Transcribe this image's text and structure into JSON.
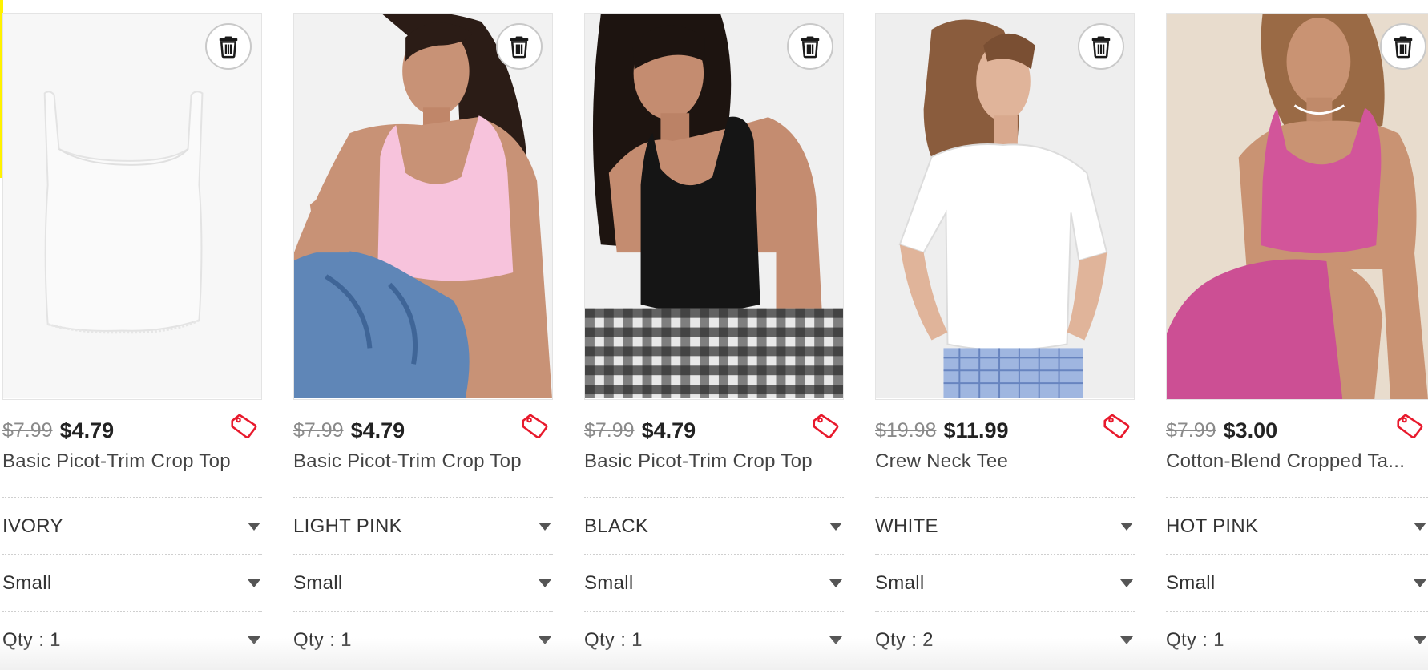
{
  "cart": {
    "items": [
      {
        "old_price": "$7.99",
        "new_price": "$4.79",
        "name": "Basic Picot-Trim Crop Top",
        "color": "IVORY",
        "size": "Small",
        "qty": "Qty : 1",
        "image": {
          "garment": "ivory tank top",
          "garment_color": "#f6f6f6",
          "background": "#f7f7f7"
        }
      },
      {
        "old_price": "$7.99",
        "new_price": "$4.79",
        "name": "Basic Picot-Trim Crop Top",
        "color": "LIGHT PINK",
        "size": "Small",
        "qty": "Qty : 1",
        "image": {
          "garment": "light pink tank top",
          "garment_color": "#f7c3dc",
          "background": "#f2f2f2"
        }
      },
      {
        "old_price": "$7.99",
        "new_price": "$4.79",
        "name": "Basic Picot-Trim Crop Top",
        "color": "BLACK",
        "size": "Small",
        "qty": "Qty : 1",
        "image": {
          "garment": "black tank top",
          "garment_color": "#151515",
          "background": "#f0f0f0"
        }
      },
      {
        "old_price": "$19.98",
        "new_price": "$11.99",
        "name": "Crew Neck Tee",
        "color": "WHITE",
        "size": "Small",
        "qty": "Qty : 2",
        "image": {
          "garment": "white crew neck tee",
          "garment_color": "#ffffff",
          "background": "#eeeeee"
        }
      },
      {
        "old_price": "$7.99",
        "new_price": "$3.00",
        "name": "Cotton-Blend Cropped Ta...",
        "color": "HOT PINK",
        "size": "Small",
        "qty": "Qty : 1",
        "image": {
          "garment": "hot pink cropped tank",
          "garment_color": "#d2559a",
          "background": "#e8dccd"
        }
      }
    ]
  },
  "icons": {
    "remove": "trash-icon",
    "sale": "price-tag-icon",
    "dropdown": "chevron-down-icon"
  },
  "colors": {
    "sale_tag": "#e8192c",
    "accent_edge": "#fff200",
    "old_price": "#8a8a8a",
    "new_price": "#222222"
  }
}
